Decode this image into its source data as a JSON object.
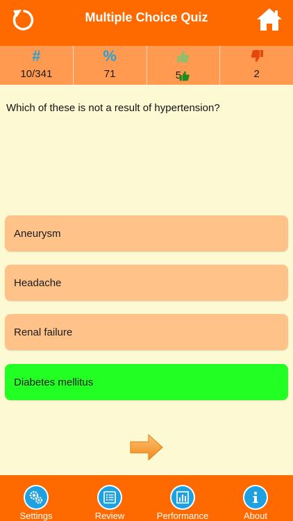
{
  "header": {
    "title": "Multiple Choice Quiz",
    "refresh_icon": "refresh-icon",
    "home_icon": "home-icon"
  },
  "stats": {
    "count": {
      "symbol": "#",
      "value": "10/341"
    },
    "percent": {
      "symbol": "%",
      "value": "71"
    },
    "correct": {
      "icon": "thumbs-up-icon",
      "value": "5"
    },
    "wrong": {
      "icon": "thumbs-down-icon",
      "value": "2"
    }
  },
  "question": "Which of these is not a result of hypertension?",
  "answers": [
    {
      "label": "Aneurysm",
      "state": "normal"
    },
    {
      "label": "Headache",
      "state": "normal"
    },
    {
      "label": "Renal failure",
      "state": "normal"
    },
    {
      "label": "Diabetes mellitus",
      "state": "correct"
    }
  ],
  "next_icon": "next-arrow-icon",
  "tabs": [
    {
      "label": "Settings",
      "icon": "gear-icon"
    },
    {
      "label": "Review",
      "icon": "list-icon"
    },
    {
      "label": "Performance",
      "icon": "bar-chart-icon"
    },
    {
      "label": "About",
      "icon": "info-icon"
    }
  ],
  "colors": {
    "primary": "#ff6a00",
    "stats_bar": "#ff9a50",
    "background": "#fdf9d2",
    "answer": "#ffc38a",
    "correct": "#22ff22",
    "accent_blue": "#1fa0e0"
  }
}
